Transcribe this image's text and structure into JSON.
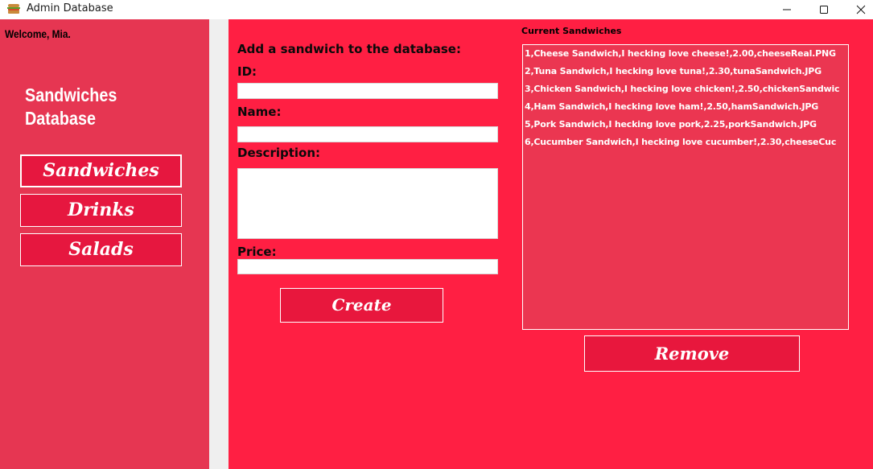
{
  "window": {
    "title": "Admin Database",
    "controls": [
      "minimize-icon",
      "maximize-icon",
      "close-icon"
    ]
  },
  "sidebar": {
    "welcome": "Welcome, Mia.",
    "title_line1": "Sandwiches",
    "title_line2": "Database",
    "items": [
      {
        "label": "Sandwiches",
        "active": true
      },
      {
        "label": "Drinks",
        "active": false
      },
      {
        "label": "Salads",
        "active": false
      }
    ]
  },
  "form": {
    "heading": "Add a sandwich to the database:",
    "id_label": "ID:",
    "id_value": "",
    "name_label": "Name:",
    "name_value": "",
    "description_label": "Description:",
    "description_value": "",
    "price_label": "Price:",
    "price_value": "",
    "create_label": "Create"
  },
  "list": {
    "title": "Current Sandwiches",
    "items": [
      "1,Cheese Sandwich,I hecking love cheese!,2.00,cheeseReal.PNG",
      "2,Tuna Sandwich,I hecking love tuna!,2.30,tunaSandwich.JPG",
      "3,Chicken Sandwich,I hecking love chicken!,2.50,chickenSandwic",
      "4,Ham Sandwich,I hecking love ham!,2.50,hamSandwich.JPG",
      "5,Pork Sandwich,I hecking love pork,2.25,porkSandwich.JPG",
      "6,Cucumber Sandwich,I hecking love cucumber!,2.30,cheeseCuc"
    ],
    "remove_label": "Remove"
  },
  "colors": {
    "sidebar_bg": "#e63652",
    "main_bg": "#ff1f43",
    "button_bg": "#e8173d",
    "listbox_bg": "#eb3651"
  }
}
